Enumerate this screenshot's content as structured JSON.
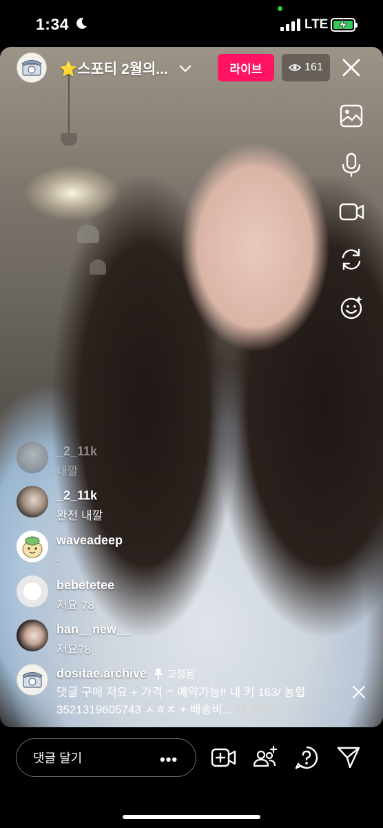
{
  "status_bar": {
    "time": "1:34",
    "network": "LTE",
    "battery_charging": true,
    "icons": [
      "moon-icon",
      "signal-icon",
      "battery-icon"
    ]
  },
  "header": {
    "title": "⭐스포티 2월의...",
    "live_label": "라이브",
    "viewer_count": "161"
  },
  "right_rail": [
    "gallery-icon",
    "microphone-icon",
    "video-camera-icon",
    "flip-camera-icon",
    "effects-icon"
  ],
  "comments": [
    {
      "user": "_2_11k",
      "text": "내깔",
      "faded": true
    },
    {
      "user": "_2_11k",
      "text": "완전 내깔"
    },
    {
      "user": "waveadeep",
      "text": "."
    },
    {
      "user": "bebetetee",
      "text": "저요 78"
    },
    {
      "user": "han__new__",
      "text": "저요78"
    }
  ],
  "pinned_comment": {
    "user": "dositae.archive",
    "pinned_label": "고정됨",
    "text": "댓글 구매 저요 + 가격 ෆ 예약가능!! 내 키 163/ 농협 3521319605743 ㅅㅎㅊ + 배송비...",
    "more_label": "더 보기"
  },
  "bottom_bar": {
    "comment_placeholder": "댓글 달기",
    "more_label": "•••",
    "icons": [
      "add-video-icon",
      "invite-guest-icon",
      "question-icon",
      "share-send-icon"
    ]
  },
  "colors": {
    "live_badge": "#ff1463",
    "background": "#000000",
    "battery": "#34c759"
  }
}
